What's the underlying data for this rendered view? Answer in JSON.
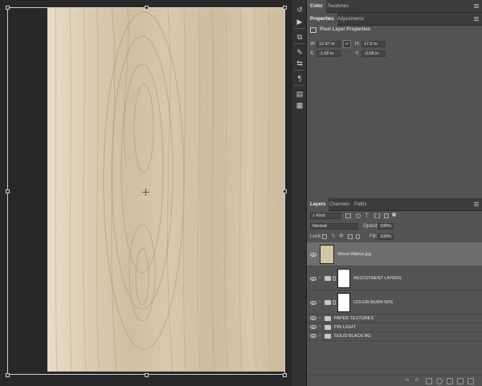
{
  "canvas": {
    "document": "Wood-Walnut.jpg"
  },
  "tools": [
    {
      "icon": "history-brush-icon"
    },
    {
      "icon": "play-icon"
    },
    {
      "icon": "shapes-icon"
    },
    {
      "icon": "brush-presets-icon"
    },
    {
      "icon": "adjust-sliders-icon"
    },
    {
      "icon": "paragraph-icon"
    },
    {
      "icon": "libraries-icon"
    },
    {
      "icon": "notes-icon"
    }
  ],
  "color_panel": {
    "tabs": [
      "Color",
      "Swatches"
    ]
  },
  "properties_panel": {
    "tabs": [
      "Properties",
      "Adjustments"
    ],
    "heading": "Pixel Layer Properties",
    "w_label": "W:",
    "w_value": "12.97 in",
    "h_label": "H:",
    "h_value": "17.5 in",
    "x_label": "X:",
    "x_value": "-1.06 in",
    "y_label": "Y:",
    "y_value": "-0.08 in"
  },
  "layers_panel": {
    "tabs": [
      "Layers",
      "Channels",
      "Paths"
    ],
    "filter_placeholder": "Kind",
    "blend_mode": "Normal",
    "opacity_label": "Opacity:",
    "opacity_value": "100%",
    "lock_label": "Lock:",
    "fill_label": "Fill:",
    "fill_value": "100%",
    "layers": [
      {
        "name": "Wood-Walnut.jpg",
        "type": "pixel",
        "selected": true
      },
      {
        "name": "ADJUSTMENT LAYERS",
        "type": "group-mask"
      },
      {
        "name": "COLOR BURN 50%",
        "type": "group-mask"
      },
      {
        "name": "PAPER TEXTURES",
        "type": "group"
      },
      {
        "name": "PIN LIGHT",
        "type": "group"
      },
      {
        "name": "SOLID BLACK BG",
        "type": "group"
      }
    ],
    "bottom_icons": [
      "link-icon",
      "fx-icon",
      "mask-icon",
      "adjustment-icon",
      "group-icon",
      "new-layer-icon",
      "trash-icon"
    ]
  },
  "colors": {
    "canvas_bg": "#282828",
    "panel_bg": "#535353",
    "selected_row": "#6e6e6e"
  }
}
